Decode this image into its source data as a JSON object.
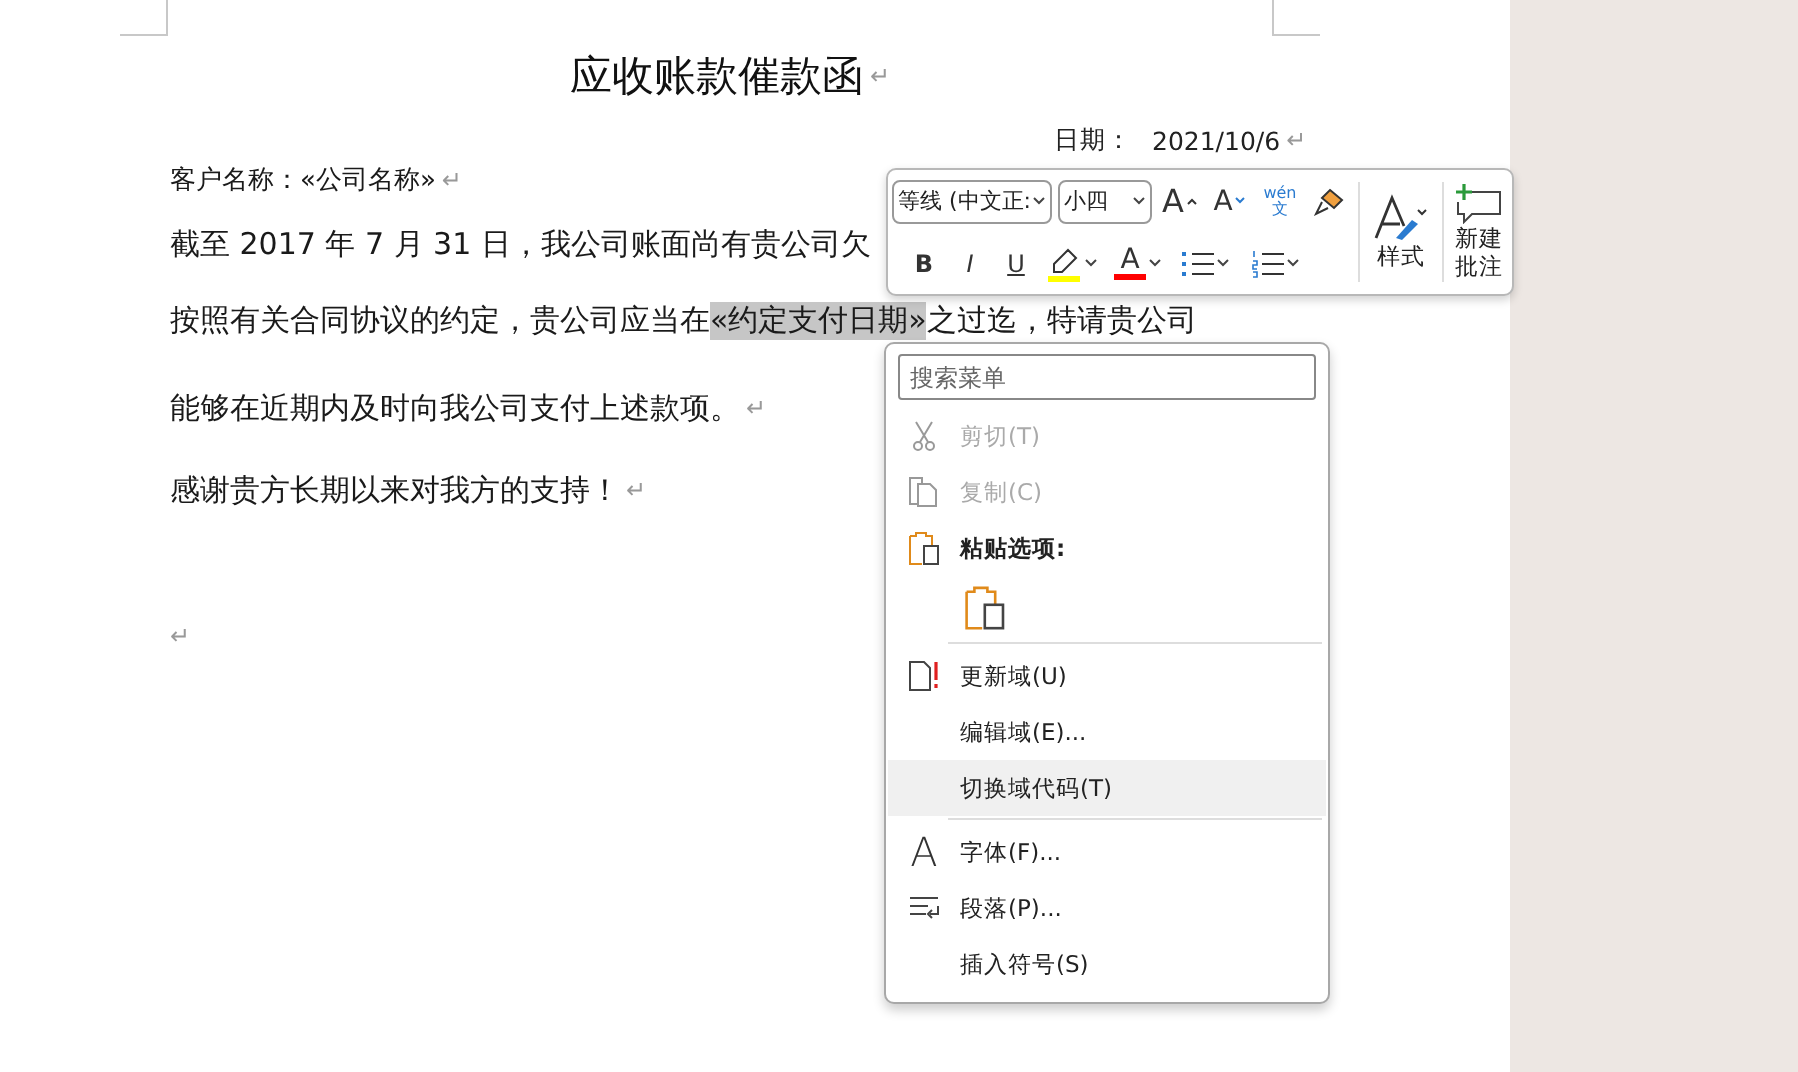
{
  "document": {
    "title": "应收账款催款函",
    "title_mark": "↵",
    "date_label": "日期：",
    "date_value": "2021/10/6",
    "date_mark": "↵",
    "paragraphs": [
      {
        "kind": "small",
        "text": "客户名称：«公司名称»",
        "mark": "↵"
      },
      {
        "kind": "body",
        "text": "截至 2017 年 7 月 31 日，我公司账面尚有贵公司欠"
      },
      {
        "kind": "field",
        "before": "按照有关合同协议的约定，贵公司应当在",
        "field": "«约定支付日期»",
        "after": "之过迄，特请贵公司"
      },
      {
        "kind": "body",
        "text": "能够在近期内及时向我公司支付上述款项。",
        "mark": "↵"
      },
      {
        "kind": "body",
        "text": "感谢贵方长期以来对我方的支持！",
        "mark": "↵"
      },
      {
        "kind": "empty",
        "mark": "↵"
      }
    ]
  },
  "toolbar": {
    "font": "等线 (中文正:",
    "size": "小四",
    "row1": [
      {
        "kind": "grow",
        "glyph": "A"
      },
      {
        "kind": "shrink",
        "glyph": "A"
      },
      {
        "kind": "phonetic",
        "top": "wén",
        "bottom": "文"
      },
      {
        "kind": "painter"
      }
    ],
    "row2": [
      {
        "kind": "bold",
        "glyph": "B"
      },
      {
        "kind": "italic",
        "glyph": "I"
      },
      {
        "kind": "underline",
        "glyph": "U"
      },
      {
        "kind": "highlight",
        "color": "#ffff00"
      },
      {
        "kind": "font_color",
        "glyph": "A",
        "color": "#ff0000"
      },
      {
        "kind": "bullets"
      },
      {
        "kind": "numbering"
      }
    ],
    "styles_label": "样式",
    "comment_label": "新建批注"
  },
  "context_menu": {
    "search_placeholder": "搜索菜单",
    "items": [
      {
        "kind": "item",
        "label": "剪切(T)",
        "disabled": true,
        "selected": false
      },
      {
        "kind": "item",
        "label": "复制(C)",
        "disabled": true,
        "selected": false
      },
      {
        "kind": "header",
        "label": "粘贴选项:"
      },
      {
        "kind": "paste"
      },
      {
        "kind": "separator"
      },
      {
        "kind": "item",
        "label": "更新域(U)",
        "disabled": false,
        "selected": false
      },
      {
        "kind": "item",
        "label": "编辑域(E)...",
        "disabled": false,
        "selected": false
      },
      {
        "kind": "item",
        "label": "切换域代码(T)",
        "disabled": false,
        "selected": true
      },
      {
        "kind": "separator"
      },
      {
        "kind": "item",
        "glyph": "A",
        "label": "字体(F)...",
        "disabled": false,
        "selected": false
      },
      {
        "kind": "item",
        "label": "段落(P)...",
        "disabled": false,
        "selected": false
      },
      {
        "kind": "item",
        "label": "插入符号(S)",
        "disabled": false,
        "selected": false
      }
    ]
  }
}
